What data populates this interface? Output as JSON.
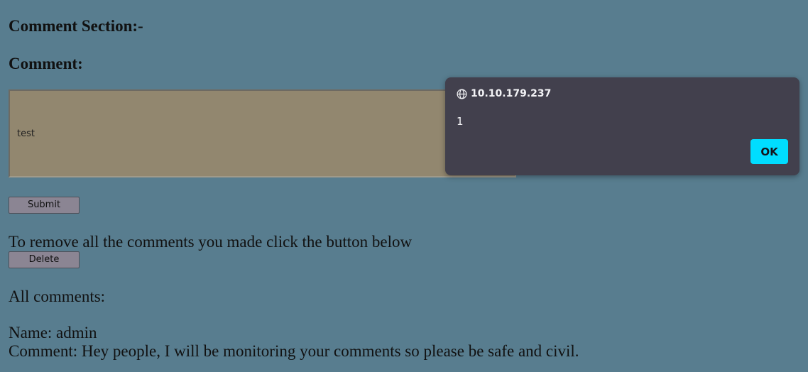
{
  "page": {
    "section_heading": "Comment Section:-",
    "comment_heading": "Comment:",
    "comment_value": "test",
    "submit_label": "Submit",
    "remove_text": "To remove all the comments you made click the button below",
    "delete_label": "Delete",
    "all_comments_label": "All comments:",
    "comments": [
      {
        "name_line": "Name: admin",
        "comment_line": "Comment: Hey people, I will be monitoring your comments so please be safe and civil."
      }
    ]
  },
  "alert": {
    "origin": "10.10.179.237",
    "origin_icon": "globe-icon",
    "message": "1",
    "ok_label": "OK",
    "ok_color": "#00ddff",
    "background": "#42404d"
  },
  "colors": {
    "page_background": "#587d8f",
    "textarea_background": "#92876f"
  }
}
